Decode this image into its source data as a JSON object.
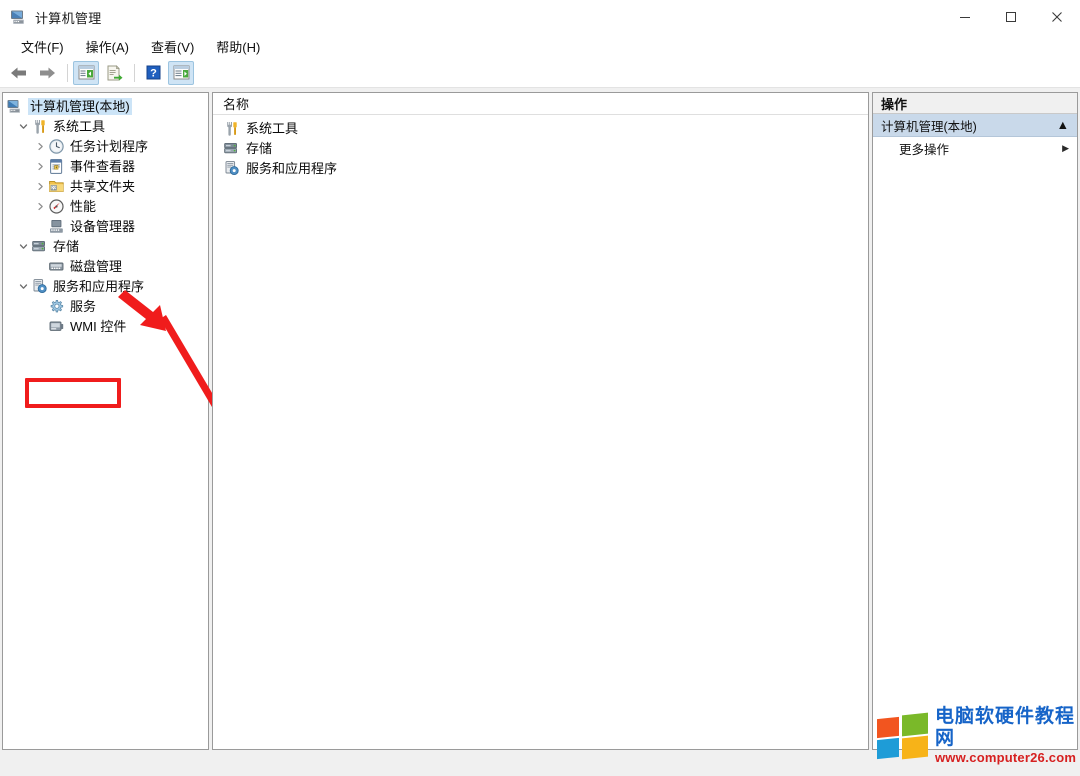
{
  "window": {
    "title": "计算机管理",
    "icon": "computer-management-icon",
    "caption": {
      "minimize": "─",
      "maximize": "□",
      "close": "✕"
    }
  },
  "menubar": {
    "items": [
      {
        "label": "文件(F)",
        "name": "menu-file"
      },
      {
        "label": "操作(A)",
        "name": "menu-action"
      },
      {
        "label": "查看(V)",
        "name": "menu-view"
      },
      {
        "label": "帮助(H)",
        "name": "menu-help"
      }
    ]
  },
  "toolbar": {
    "items": [
      {
        "name": "back-arrow-icon",
        "label": "后退"
      },
      {
        "name": "forward-arrow-icon",
        "label": "前进"
      },
      {
        "name": "show-hide-tree-icon",
        "label": "显示/隐藏控制台树"
      },
      {
        "name": "export-list-icon",
        "label": "导出列表"
      },
      {
        "name": "help-icon",
        "label": "帮助"
      },
      {
        "name": "show-action-pane-icon",
        "label": "显示/隐藏操作窗格"
      }
    ]
  },
  "tree": {
    "items": [
      {
        "label": "计算机管理(本地)",
        "icon": "computer-icon",
        "indent": 0,
        "twist": "",
        "selected": true
      },
      {
        "label": "系统工具",
        "icon": "system-tools-icon",
        "indent": 1,
        "twist": "expanded",
        "selected": false
      },
      {
        "label": "任务计划程序",
        "icon": "task-scheduler-icon",
        "indent": 2,
        "twist": "collapsed",
        "selected": false
      },
      {
        "label": "事件查看器",
        "icon": "event-viewer-icon",
        "indent": 2,
        "twist": "collapsed",
        "selected": false
      },
      {
        "label": "共享文件夹",
        "icon": "shared-folders-icon",
        "indent": 2,
        "twist": "collapsed",
        "selected": false
      },
      {
        "label": "性能",
        "icon": "performance-icon",
        "indent": 2,
        "twist": "collapsed",
        "selected": false
      },
      {
        "label": "设备管理器",
        "icon": "device-manager-icon",
        "indent": 2,
        "twist": "",
        "selected": false
      },
      {
        "label": "存储",
        "icon": "storage-icon",
        "indent": 1,
        "twist": "expanded",
        "selected": false
      },
      {
        "label": "磁盘管理",
        "icon": "disk-management-icon",
        "indent": 2,
        "twist": "",
        "selected": false
      },
      {
        "label": "服务和应用程序",
        "icon": "services-apps-icon",
        "indent": 1,
        "twist": "expanded",
        "selected": false
      },
      {
        "label": "服务",
        "icon": "services-icon",
        "indent": 2,
        "twist": "",
        "selected": false
      },
      {
        "label": "WMI 控件",
        "icon": "wmi-control-icon",
        "indent": 2,
        "twist": "",
        "selected": false
      }
    ]
  },
  "list": {
    "column_header": "名称",
    "rows": [
      {
        "label": "系统工具",
        "icon": "system-tools-icon"
      },
      {
        "label": "存储",
        "icon": "storage-icon"
      },
      {
        "label": "服务和应用程序",
        "icon": "services-apps-icon"
      }
    ]
  },
  "actions": {
    "title": "操作",
    "group": {
      "label": "计算机管理(本地)",
      "caret": "▲"
    },
    "items": [
      {
        "label": "更多操作",
        "caret": "▶"
      }
    ]
  },
  "annotation": {
    "highlight_color": "#f01c1c",
    "highlight_target": "服务",
    "arrow": "red-arrow-pointing-to-services"
  },
  "watermark": {
    "brand": "电脑软硬件教程网",
    "url": "www.computer26.com",
    "brand_color": "#1664c8",
    "url_color": "#d62020"
  }
}
